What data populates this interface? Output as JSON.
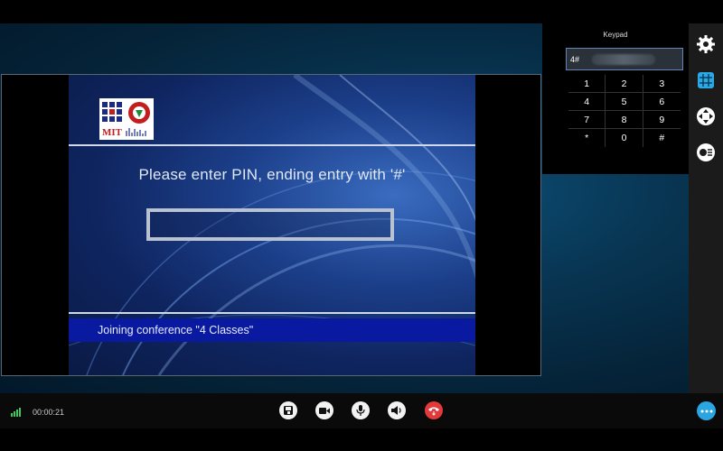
{
  "call": {
    "timer": "00:00:21"
  },
  "slide": {
    "logo_text": "MIT",
    "prompt": "Please enter PIN, ending entry with '#'",
    "status": "Joining conference \"4 Classes\""
  },
  "keypad": {
    "title": "Keypad",
    "input_value": "4#",
    "keys": [
      "1",
      "2",
      "3",
      "4",
      "5",
      "6",
      "7",
      "8",
      "9",
      "*",
      "0",
      "#"
    ]
  },
  "sidebar": {
    "items": [
      {
        "icon": "gear-icon"
      },
      {
        "icon": "keypad-icon"
      },
      {
        "icon": "camera-control-icon"
      },
      {
        "icon": "layout-icon"
      }
    ]
  },
  "controls": {
    "items": [
      {
        "icon": "share-icon"
      },
      {
        "icon": "video-icon"
      },
      {
        "icon": "microphone-icon"
      },
      {
        "icon": "speaker-icon"
      },
      {
        "icon": "hangup-icon"
      },
      {
        "icon": "more-icon"
      }
    ]
  },
  "colors": {
    "accent": "#2aa5e0",
    "hangup": "#e23a3a",
    "signal": "#3cc85a",
    "status_strip": "#0a1aa0"
  }
}
